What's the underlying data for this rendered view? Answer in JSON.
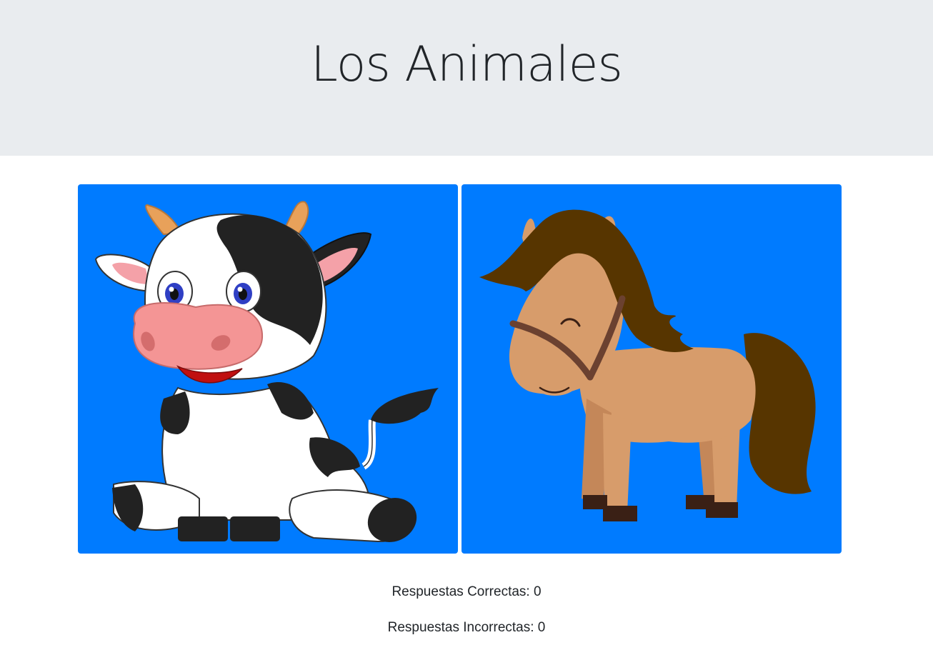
{
  "header": {
    "title": "Los Animales"
  },
  "options": [
    {
      "animal": "cow",
      "icon": "cow-icon"
    },
    {
      "animal": "horse",
      "icon": "horse-icon"
    }
  ],
  "score": {
    "correct_label": "Respuestas Correctas: 0",
    "incorrect_label": "Respuestas Incorrectas: 0"
  },
  "colors": {
    "header_bg": "#e9ecef",
    "card_bg": "#007bff",
    "text": "#212529"
  }
}
